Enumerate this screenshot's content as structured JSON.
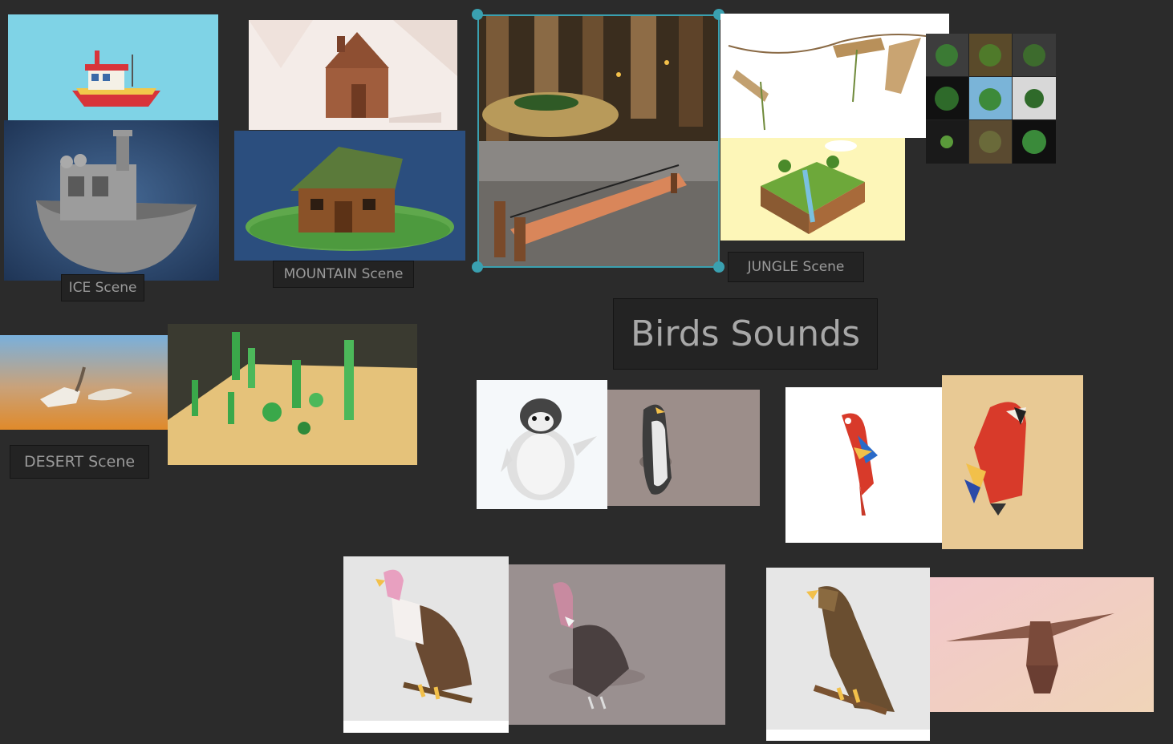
{
  "board": {
    "labels": {
      "ice": "ICE Scene",
      "mountain": "MOUNTAIN Scene",
      "jungle": "JUNGLE Scene",
      "desert": "DESERT Scene"
    },
    "title": "Birds Sounds"
  },
  "colors": {
    "background": "#2b2b2b",
    "selection": "#3aa0b0"
  }
}
